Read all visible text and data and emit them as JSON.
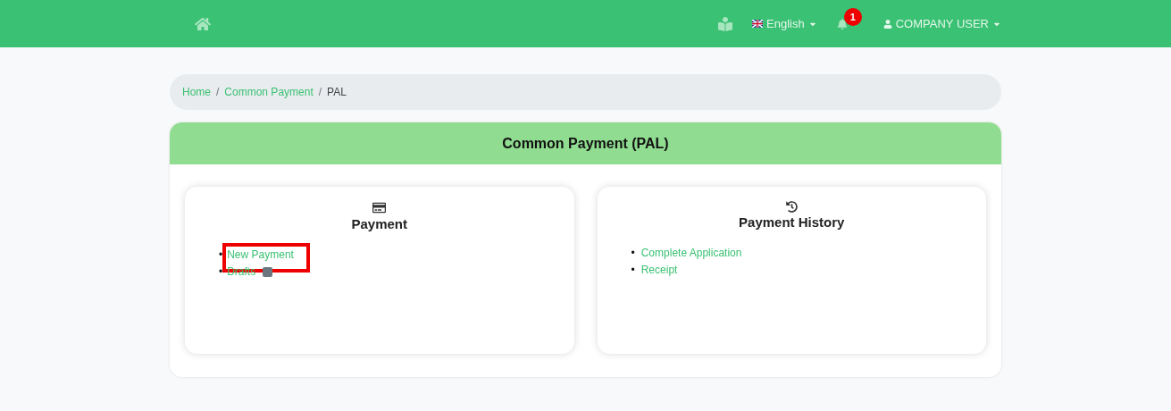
{
  "navbar": {
    "language": "English",
    "notifications": "1",
    "user": "COMPANY USER"
  },
  "breadcrumb": [
    {
      "label": "Home",
      "link": true
    },
    {
      "separator": "/",
      "label": "Common Payment",
      "link": true
    },
    {
      "separator": "/",
      "label": "PAL",
      "link": false
    }
  ],
  "card": {
    "title": "Common Payment (PAL)"
  },
  "panels": [
    {
      "kind": "payment",
      "title": "Payment",
      "links": [
        {
          "bullet": "•",
          "label": "New Payment",
          "highlighted": true,
          "badge": false
        },
        {
          "bullet": "•",
          "label": "Drafts",
          "highlighted": false,
          "badge": true
        }
      ]
    },
    {
      "kind": "history",
      "title": "Payment History",
      "links": [
        {
          "bullet": "•",
          "label": "Complete Application",
          "highlighted": false,
          "badge": false
        },
        {
          "bullet": "•",
          "label": "Receipt",
          "highlighted": false,
          "badge": false
        }
      ]
    }
  ]
}
